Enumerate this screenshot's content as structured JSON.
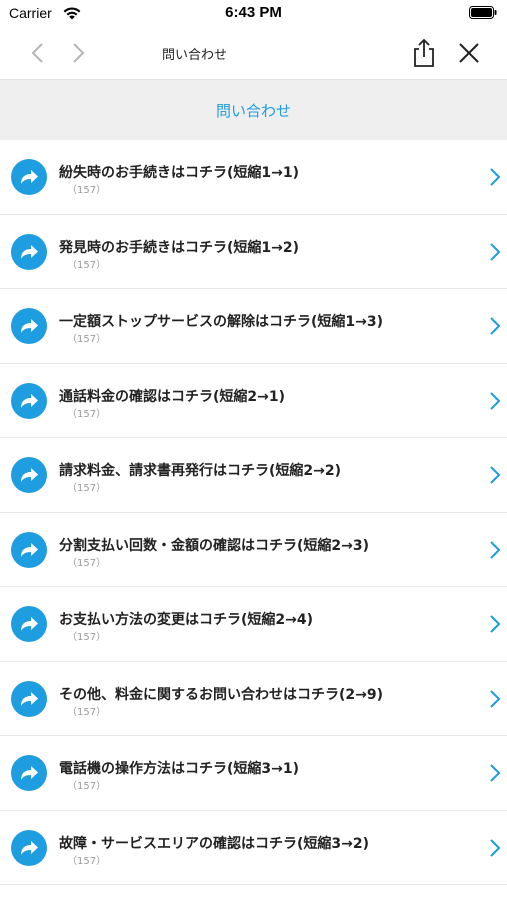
{
  "status_bar": {
    "carrier": "Carrier",
    "time": "6:43 PM"
  },
  "nav": {
    "title": "問い合わせ",
    "back_icon": "chevron-left-icon",
    "forward_icon": "chevron-right-icon",
    "share_icon": "share-icon",
    "close_icon": "close-icon"
  },
  "header": {
    "title": "問い合わせ"
  },
  "colors": {
    "accent": "#1e9de0",
    "header_band": "#efefef"
  },
  "items": [
    {
      "label": "紛失時のお手続きはコチラ(短縮1→1)",
      "sub": "（157）"
    },
    {
      "label": "発見時のお手続きはコチラ(短縮1→2)",
      "sub": "（157）"
    },
    {
      "label": "一定額ストップサービスの解除はコチラ(短縮1→3)",
      "sub": "（157）"
    },
    {
      "label": "通話料金の確認はコチラ(短縮2→1)",
      "sub": "（157）"
    },
    {
      "label": "請求料金、請求書再発行はコチラ(短縮2→2)",
      "sub": "（157）"
    },
    {
      "label": "分割支払い回数・金額の確認はコチラ(短縮2→3)",
      "sub": "（157）"
    },
    {
      "label": "お支払い方法の変更はコチラ(短縮2→4)",
      "sub": "（157）"
    },
    {
      "label": "その他、料金に関するお問い合わせはコチラ(2→9)",
      "sub": "（157）"
    },
    {
      "label": "電話機の操作方法はコチラ(短縮3→1)",
      "sub": "（157）"
    },
    {
      "label": "故障・サービスエリアの確認はコチラ(短縮3→2)",
      "sub": "（157）"
    }
  ]
}
